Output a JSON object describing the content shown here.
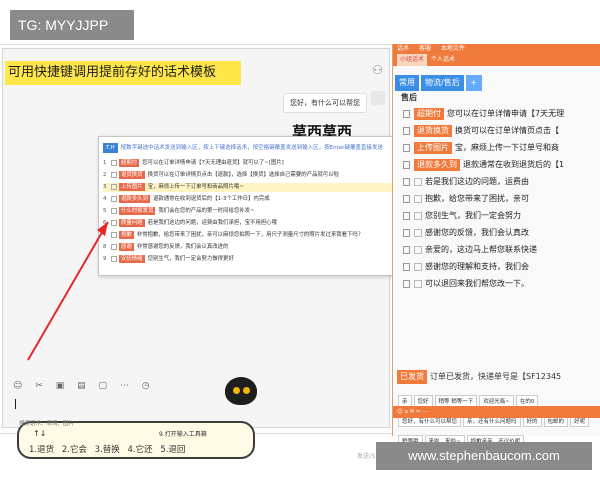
{
  "watermark": {
    "tag": "TG: MYYJJPP",
    "url": "www.stephenbaucom.com"
  },
  "chat": {
    "banner": "可用快捷键调用提前存好的话术模板",
    "bubble": "您好，有什么可以帮您",
    "sticker_title": "莫西莫西",
    "toolbar_icons": [
      "☺",
      "✂",
      "▣",
      "▤",
      "▢",
      "⋯",
      "◷"
    ],
    "send_label": "发送(S)",
    "status": "搜索话术、表情、图片"
  },
  "popup": {
    "th": "T.H",
    "hint": "按数字键选中话术发送到输入区，按上下键选择话术，按空格键覆盖发送到输入区，按Enter键覆盖直接发送",
    "sort": "排序",
    "rows": [
      {
        "n": "1",
        "tag": "超期付",
        "color": "#e8684a",
        "text": "您可以在订单详情申请【7天无理由退货】就可以了~[图片]"
      },
      {
        "n": "2",
        "tag": "退货换货",
        "color": "#e8684a",
        "text": "换货可以在订单详情页点击【退款】，选择【换货】选择自己需要的产品就可以啦"
      },
      {
        "n": "3",
        "tag": "上传图片",
        "color": "#e8684a",
        "text": "宝，麻烦上传一下订单号和商品照片哦~",
        "hl": true
      },
      {
        "n": "4",
        "tag": "退款多久到",
        "color": "#e8684a",
        "text": "退款通常在收到退货后的【1-3个工作日】内完成"
      },
      {
        "n": "5",
        "tag": "什么时候发货",
        "color": "#e8684a",
        "text": "我们会在您的产品的第一时间给您补发~"
      },
      {
        "n": "6",
        "tag": "质量问题",
        "color": "#e8684a",
        "text": "若是我们这边的问题，运费由我们承担，宝不用担心哦"
      },
      {
        "n": "7",
        "tag": "抱歉",
        "color": "#e8684a",
        "text": "非常抱歉，给您带来了困扰，亲可以麻烦您拍照一下，用尺子测量尺寸的照片发过来我看下吗？"
      },
      {
        "n": "8",
        "tag": "感谢",
        "color": "#e8684a",
        "text": "非常感谢您的反馈，我们会认真改进的"
      },
      {
        "n": "9",
        "tag": "安抚情绪",
        "color": "#e8684a",
        "text": "您别生气，我们一定会努力做得更好"
      }
    ]
  },
  "keybox": {
    "num": "↑↓",
    "open": "9.打开输入工具箱",
    "items": [
      "1.退货",
      "2.它会",
      "3.替换",
      "4.它还",
      "5.退回"
    ]
  },
  "right": {
    "tabs": [
      "话术",
      "客服",
      "本地文件"
    ],
    "sub_box": "小组话术",
    "sub_text": "个人话术",
    "buttons": [
      "常用",
      "物流/售后",
      "+"
    ],
    "section": "售后",
    "rows": [
      {
        "tag": "超期付",
        "text": "您可以在订单详情申请【7天无理"
      },
      {
        "tag": "退货换货",
        "text": "换货可以在订单详情页点击【"
      },
      {
        "tag": "上传图片",
        "text": "宝，麻烦上传一下订单号和商"
      },
      {
        "tag": "退款多久到",
        "text": "退款通常在收到退货后的【1"
      },
      {
        "tag": "",
        "text": "若是我们这边的问题，运费由"
      },
      {
        "tag": "",
        "text": "抱歉，给您带来了困扰，亲可"
      },
      {
        "tag": "",
        "text": "您别生气，我们一定会努力"
      },
      {
        "tag": "",
        "text": "感谢您的反馈，我们会认真改"
      },
      {
        "tag": "",
        "text": "亲爱的，这边马上帮您联系快递"
      },
      {
        "tag": "",
        "text": "感谢您的理解和支持，我们会"
      },
      {
        "tag": "",
        "text": "可以退回来我们帮您改一下。"
      }
    ],
    "footer_tag": "已发货",
    "footer_text": "订单已发货，快递单号是【SF12345",
    "chips": [
      "亲",
      "您好",
      "稍等 稍等一下",
      "欢迎光临~",
      "在的0",
      "您好，有什么可以帮您",
      "亲，还有什么问题吗",
      "好的",
      "包邮的",
      "好呢",
      "稍等哦",
      "来啦、来啦~",
      "抱歉亲亲，不议价呢"
    ],
    "bottom": "☺  ⌂  ✉  ✂  ⋯"
  }
}
